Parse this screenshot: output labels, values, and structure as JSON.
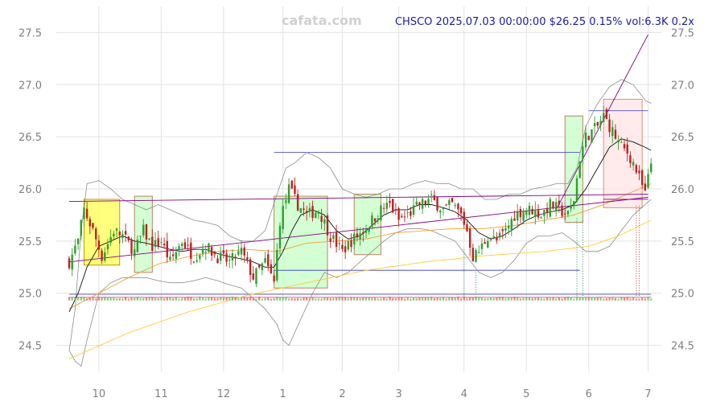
{
  "watermark": "cafata.com",
  "header": "CHSCO 2025.07.03 00:00:00 $26.25 0.15% vol:6.3K 0.2x",
  "chart_data": {
    "type": "candlestick",
    "ticker": "CHSCO",
    "last": {
      "date": "2025.07.03",
      "close": 26.25,
      "change_pct": 0.15,
      "volume": "6.3K",
      "rel_volume": "0.2x"
    },
    "ylim": [
      24.25,
      27.75
    ],
    "y_ticks": [
      24.5,
      25.0,
      25.5,
      26.0,
      26.5,
      27.0,
      27.5
    ],
    "x_ticks": [
      {
        "label": "10",
        "day": 10
      },
      {
        "label": "11",
        "day": 31
      },
      {
        "label": "12",
        "day": 52
      },
      {
        "label": "1",
        "day": 72
      },
      {
        "label": "2",
        "day": 92
      },
      {
        "label": "3",
        "day": 111
      },
      {
        "label": "4",
        "day": 133
      },
      {
        "label": "5",
        "day": 154
      },
      {
        "label": "6",
        "day": 175
      },
      {
        "label": "7",
        "day": 195
      }
    ],
    "close_anchors": [
      [
        0,
        25.3
      ],
      [
        3,
        25.5
      ],
      [
        5,
        25.8
      ],
      [
        8,
        25.6
      ],
      [
        11,
        25.35
      ],
      [
        15,
        25.6
      ],
      [
        18,
        25.55
      ],
      [
        22,
        25.4
      ],
      [
        25,
        25.6
      ],
      [
        28,
        25.45
      ],
      [
        31,
        25.5
      ],
      [
        34,
        25.3
      ],
      [
        38,
        25.5
      ],
      [
        42,
        25.35
      ],
      [
        46,
        25.45
      ],
      [
        50,
        25.35
      ],
      [
        54,
        25.3
      ],
      [
        58,
        25.4
      ],
      [
        62,
        25.15
      ],
      [
        66,
        25.3
      ],
      [
        69,
        25.1
      ],
      [
        71,
        25.7
      ],
      [
        74,
        26.0
      ],
      [
        77,
        25.85
      ],
      [
        80,
        25.75
      ],
      [
        84,
        25.8
      ],
      [
        88,
        25.55
      ],
      [
        92,
        25.4
      ],
      [
        95,
        25.5
      ],
      [
        99,
        25.6
      ],
      [
        102,
        25.7
      ],
      [
        105,
        25.8
      ],
      [
        108,
        25.85
      ],
      [
        111,
        25.7
      ],
      [
        114,
        25.75
      ],
      [
        118,
        25.85
      ],
      [
        122,
        25.9
      ],
      [
        126,
        25.8
      ],
      [
        129,
        25.85
      ],
      [
        132,
        25.75
      ],
      [
        134,
        25.6
      ],
      [
        136,
        25.35
      ],
      [
        138,
        25.4
      ],
      [
        141,
        25.55
      ],
      [
        144,
        25.5
      ],
      [
        147,
        25.6
      ],
      [
        150,
        25.75
      ],
      [
        153,
        25.8
      ],
      [
        156,
        25.8
      ],
      [
        159,
        25.75
      ],
      [
        162,
        25.85
      ],
      [
        165,
        25.8
      ],
      [
        168,
        25.75
      ],
      [
        170,
        25.9
      ],
      [
        172,
        26.3
      ],
      [
        174,
        26.5
      ],
      [
        176,
        26.55
      ],
      [
        178,
        26.6
      ],
      [
        180,
        26.7
      ],
      [
        182,
        26.6
      ],
      [
        184,
        26.5
      ],
      [
        186,
        26.4
      ],
      [
        188,
        26.35
      ],
      [
        190,
        26.25
      ],
      [
        192,
        26.1
      ],
      [
        194,
        25.95
      ],
      [
        196,
        26.25
      ]
    ],
    "sma_short_anchors": [
      [
        0,
        24.82
      ],
      [
        3,
        25.0
      ],
      [
        6,
        25.25
      ],
      [
        10,
        25.45
      ],
      [
        14,
        25.5
      ],
      [
        18,
        25.55
      ],
      [
        22,
        25.5
      ],
      [
        26,
        25.48
      ],
      [
        30,
        25.45
      ],
      [
        34,
        25.42
      ],
      [
        38,
        25.4
      ],
      [
        42,
        25.42
      ],
      [
        46,
        25.42
      ],
      [
        50,
        25.38
      ],
      [
        54,
        25.35
      ],
      [
        58,
        25.33
      ],
      [
        62,
        25.3
      ],
      [
        66,
        25.25
      ],
      [
        69,
        25.25
      ],
      [
        72,
        25.4
      ],
      [
        75,
        25.6
      ],
      [
        78,
        25.75
      ],
      [
        82,
        25.8
      ],
      [
        86,
        25.75
      ],
      [
        90,
        25.6
      ],
      [
        94,
        25.52
      ],
      [
        98,
        25.55
      ],
      [
        102,
        25.65
      ],
      [
        106,
        25.75
      ],
      [
        110,
        25.8
      ],
      [
        114,
        25.8
      ],
      [
        118,
        25.85
      ],
      [
        122,
        25.85
      ],
      [
        126,
        25.82
      ],
      [
        130,
        25.78
      ],
      [
        134,
        25.7
      ],
      [
        138,
        25.58
      ],
      [
        142,
        25.52
      ],
      [
        146,
        25.55
      ],
      [
        150,
        25.62
      ],
      [
        154,
        25.7
      ],
      [
        158,
        25.75
      ],
      [
        162,
        25.78
      ],
      [
        166,
        25.8
      ],
      [
        170,
        25.85
      ],
      [
        174,
        26.0
      ],
      [
        178,
        26.2
      ],
      [
        182,
        26.4
      ],
      [
        186,
        26.48
      ],
      [
        190,
        26.45
      ],
      [
        194,
        26.4
      ],
      [
        196,
        26.37
      ]
    ],
    "sma_mid_anchors": [
      [
        0,
        24.85
      ],
      [
        10,
        25.0
      ],
      [
        20,
        25.15
      ],
      [
        30,
        25.28
      ],
      [
        40,
        25.35
      ],
      [
        50,
        25.4
      ],
      [
        60,
        25.42
      ],
      [
        70,
        25.4
      ],
      [
        80,
        25.48
      ],
      [
        90,
        25.5
      ],
      [
        100,
        25.52
      ],
      [
        110,
        25.58
      ],
      [
        120,
        25.6
      ],
      [
        130,
        25.62
      ],
      [
        140,
        25.62
      ],
      [
        150,
        25.65
      ],
      [
        160,
        25.7
      ],
      [
        170,
        25.75
      ],
      [
        180,
        25.85
      ],
      [
        188,
        25.95
      ],
      [
        196,
        26.05
      ]
    ],
    "sma_long_anchors": [
      [
        0,
        24.37
      ],
      [
        20,
        24.62
      ],
      [
        40,
        24.82
      ],
      [
        60,
        24.98
      ],
      [
        80,
        25.1
      ],
      [
        100,
        25.22
      ],
      [
        120,
        25.3
      ],
      [
        140,
        25.36
      ],
      [
        160,
        25.4
      ],
      [
        175,
        25.45
      ],
      [
        185,
        25.55
      ],
      [
        196,
        25.7
      ]
    ],
    "bb_upper_anchors": [
      [
        0,
        24.45
      ],
      [
        2,
        24.85
      ],
      [
        4,
        25.6
      ],
      [
        6,
        26.05
      ],
      [
        10,
        26.08
      ],
      [
        14,
        26.0
      ],
      [
        18,
        25.9
      ],
      [
        22,
        25.85
      ],
      [
        26,
        25.8
      ],
      [
        30,
        25.85
      ],
      [
        34,
        25.8
      ],
      [
        38,
        25.75
      ],
      [
        42,
        25.7
      ],
      [
        46,
        25.68
      ],
      [
        50,
        25.65
      ],
      [
        54,
        25.55
      ],
      [
        58,
        25.5
      ],
      [
        62,
        25.5
      ],
      [
        66,
        25.6
      ],
      [
        70,
        25.95
      ],
      [
        73,
        26.2
      ],
      [
        76,
        26.25
      ],
      [
        80,
        26.35
      ],
      [
        84,
        26.3
      ],
      [
        88,
        26.2
      ],
      [
        92,
        26.0
      ],
      [
        96,
        25.95
      ],
      [
        100,
        25.92
      ],
      [
        104,
        25.95
      ],
      [
        108,
        26.0
      ],
      [
        112,
        26.0
      ],
      [
        116,
        26.05
      ],
      [
        120,
        26.08
      ],
      [
        124,
        26.05
      ],
      [
        128,
        26.05
      ],
      [
        132,
        26.0
      ],
      [
        136,
        26.0
      ],
      [
        140,
        25.9
      ],
      [
        144,
        25.9
      ],
      [
        148,
        25.95
      ],
      [
        152,
        25.95
      ],
      [
        156,
        26.0
      ],
      [
        160,
        26.02
      ],
      [
        164,
        26.05
      ],
      [
        168,
        26.05
      ],
      [
        171,
        26.2
      ],
      [
        174,
        26.6
      ],
      [
        178,
        26.82
      ],
      [
        182,
        26.98
      ],
      [
        186,
        27.05
      ],
      [
        190,
        27.0
      ],
      [
        194,
        26.85
      ],
      [
        196,
        26.82
      ]
    ],
    "bb_lower_anchors": [
      [
        0,
        24.45
      ],
      [
        2,
        24.35
      ],
      [
        4,
        24.3
      ],
      [
        6,
        24.55
      ],
      [
        10,
        25.0
      ],
      [
        14,
        25.1
      ],
      [
        18,
        25.15
      ],
      [
        22,
        25.15
      ],
      [
        26,
        25.15
      ],
      [
        30,
        25.12
      ],
      [
        34,
        25.1
      ],
      [
        38,
        25.1
      ],
      [
        42,
        25.12
      ],
      [
        46,
        25.15
      ],
      [
        50,
        25.12
      ],
      [
        54,
        25.08
      ],
      [
        58,
        25.05
      ],
      [
        62,
        24.95
      ],
      [
        66,
        24.85
      ],
      [
        70,
        24.7
      ],
      [
        72,
        24.55
      ],
      [
        74,
        24.5
      ],
      [
        78,
        24.75
      ],
      [
        82,
        25.0
      ],
      [
        86,
        25.2
      ],
      [
        90,
        25.15
      ],
      [
        94,
        25.2
      ],
      [
        98,
        25.3
      ],
      [
        102,
        25.4
      ],
      [
        106,
        25.5
      ],
      [
        110,
        25.58
      ],
      [
        114,
        25.62
      ],
      [
        118,
        25.62
      ],
      [
        122,
        25.6
      ],
      [
        126,
        25.55
      ],
      [
        130,
        25.5
      ],
      [
        134,
        25.35
      ],
      [
        138,
        25.2
      ],
      [
        142,
        25.15
      ],
      [
        146,
        25.2
      ],
      [
        150,
        25.32
      ],
      [
        154,
        25.48
      ],
      [
        158,
        25.55
      ],
      [
        162,
        25.55
      ],
      [
        166,
        25.58
      ],
      [
        170,
        25.5
      ],
      [
        174,
        25.4
      ],
      [
        178,
        25.4
      ],
      [
        182,
        25.45
      ],
      [
        186,
        25.6
      ],
      [
        190,
        25.75
      ],
      [
        194,
        25.85
      ],
      [
        196,
        25.9
      ]
    ],
    "zones": [
      {
        "from": 5,
        "to": 17,
        "low": 25.27,
        "high": 25.9,
        "fill": "#ffff66",
        "stroke": "#b8a000"
      },
      {
        "from": 22,
        "to": 28,
        "low": 25.2,
        "high": 25.93,
        "fill": "#ccffcc",
        "stroke": "#c08060"
      },
      {
        "from": 69,
        "to": 87,
        "low": 25.05,
        "high": 25.93,
        "fill": "#ccffcc",
        "stroke": "#c08060"
      },
      {
        "from": 96,
        "to": 105,
        "low": 25.37,
        "high": 25.95,
        "fill": "#ccffcc",
        "stroke": "#c08060"
      },
      {
        "from": 167,
        "to": 173,
        "low": 25.68,
        "high": 26.7,
        "fill": "#ccffcc",
        "stroke": "#c08060"
      },
      {
        "from": 180,
        "to": 193,
        "low": 25.82,
        "high": 26.86,
        "fill": "#ffe8e8",
        "stroke": "#e09070"
      }
    ],
    "hlines": [
      {
        "from": 69,
        "to": 172,
        "y": 26.35,
        "color": "#3333cc"
      },
      {
        "from": 69,
        "to": 172,
        "y": 25.22,
        "color": "#3333cc"
      },
      {
        "from": 175,
        "to": 195,
        "y": 26.75,
        "color": "#3333cc"
      },
      {
        "from": 0,
        "to": 196,
        "y": 24.99,
        "color": "#3333cc"
      },
      {
        "from": 0,
        "to": 196,
        "y": 24.96,
        "color": "#cc3333"
      }
    ],
    "trendlines": [
      {
        "x1": 0,
        "y1": 25.88,
        "x2": 195,
        "y2": 25.95,
        "color": "#800080"
      },
      {
        "x1": 0,
        "y1": 25.3,
        "x2": 195,
        "y2": 25.92,
        "color": "#800080"
      },
      {
        "x1": 164,
        "y1": 25.8,
        "x2": 195,
        "y2": 27.48,
        "color": "#800080"
      },
      {
        "x1": 180,
        "y1": 25.9,
        "x2": 195,
        "y2": 25.9,
        "color": "#800080"
      }
    ],
    "vmarkers": [
      {
        "day": 133,
        "from": 25.42,
        "to": 24.96,
        "color": "#2e8b57"
      },
      {
        "day": 137,
        "from": 25.2,
        "to": 24.96,
        "color": "#2e8b57"
      },
      {
        "day": 171,
        "from": 25.72,
        "to": 24.96,
        "color": "#2e8b57"
      },
      {
        "day": 173,
        "from": 25.7,
        "to": 24.96,
        "color": "#2e8b57"
      },
      {
        "day": 191,
        "from": 25.84,
        "to": 24.96,
        "color": "#cc3333"
      },
      {
        "day": 192,
        "from": 25.84,
        "to": 24.96,
        "color": "#cc3333"
      }
    ]
  }
}
